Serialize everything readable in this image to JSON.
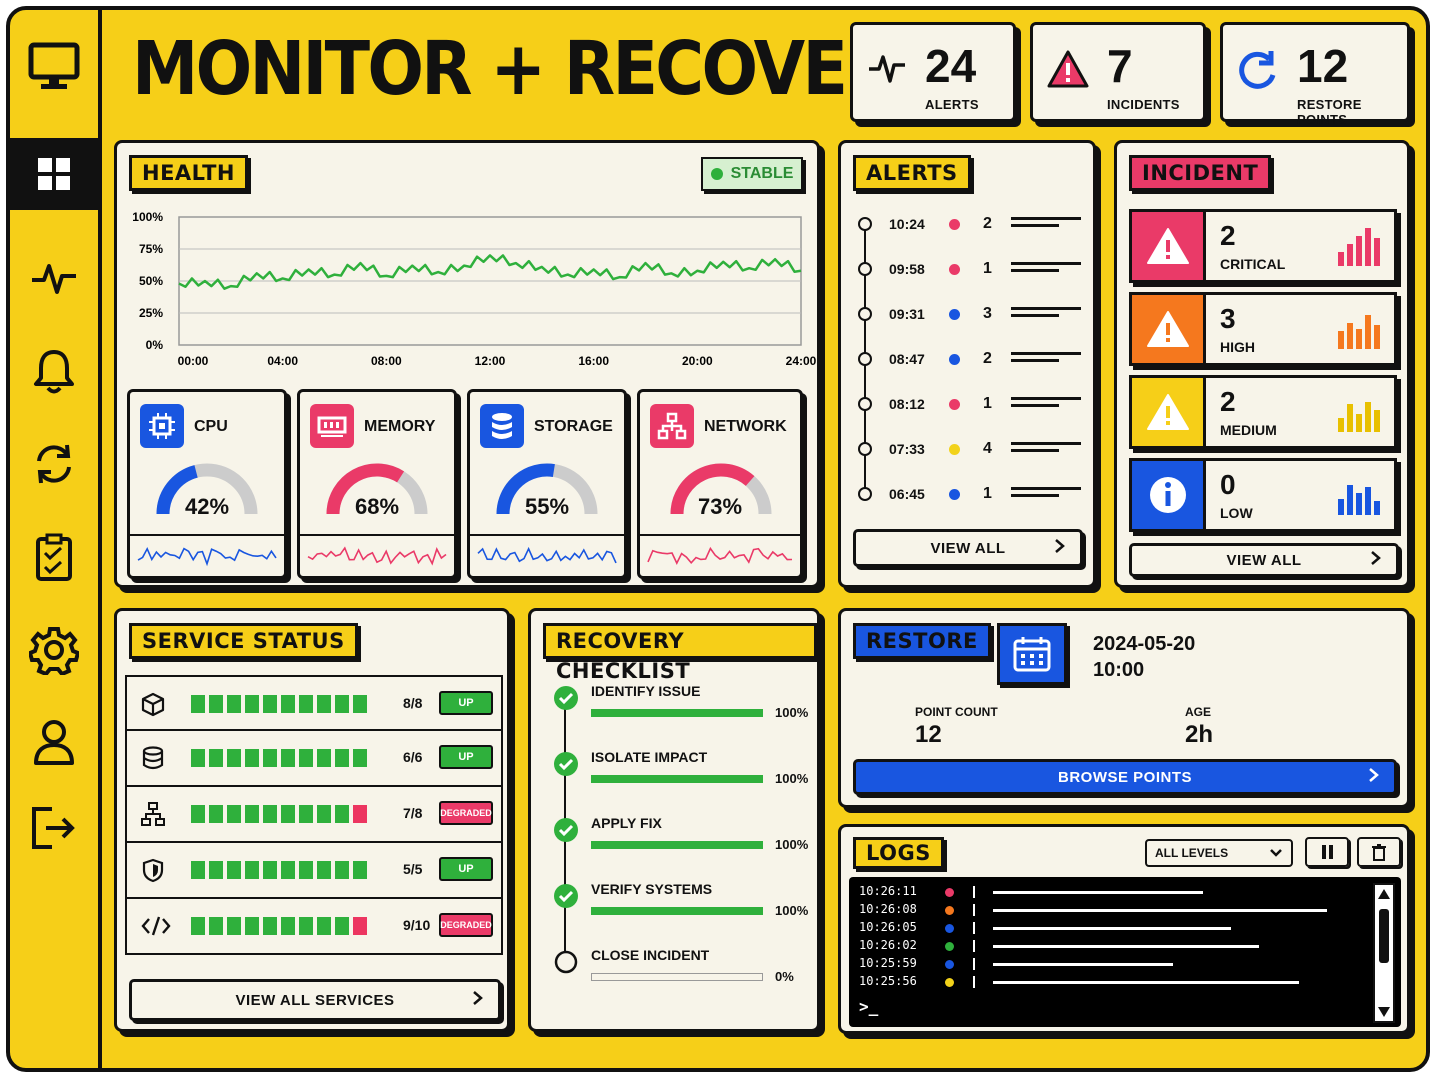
{
  "app": {
    "title": "MONITOR + RECOVER"
  },
  "header_stats": [
    {
      "value": "24",
      "label": "ALERTS",
      "icon": "pulse-icon"
    },
    {
      "value": "7",
      "label": "INCIDENTS",
      "icon": "warning-icon"
    },
    {
      "value": "12",
      "label": "RESTORE POINTS",
      "icon": "restore-icon"
    }
  ],
  "sidebar": {
    "items": [
      "monitor-logo",
      "dashboard",
      "activity",
      "notifications",
      "sync",
      "checklist",
      "settings",
      "profile",
      "logout"
    ]
  },
  "health": {
    "title": "HEALTH",
    "status": "STABLE",
    "y_ticks": [
      "100%",
      "75%",
      "50%",
      "25%",
      "0%"
    ],
    "x_ticks": [
      "00:00",
      "04:00",
      "08:00",
      "12:00",
      "16:00",
      "20:00",
      "24:00"
    ]
  },
  "chart_data": {
    "type": "line",
    "title": "",
    "xlabel": "",
    "ylabel": "",
    "ylim": [
      0,
      100
    ],
    "grid": true,
    "x": [
      "00:00",
      "01:00",
      "02:00",
      "03:00",
      "04:00",
      "05:00",
      "06:00",
      "07:00",
      "08:00",
      "09:00",
      "10:00",
      "11:00",
      "12:00",
      "13:00",
      "14:00",
      "15:00",
      "16:00",
      "17:00",
      "18:00",
      "19:00",
      "20:00",
      "21:00",
      "22:00",
      "23:00",
      "24:00"
    ],
    "series": [
      {
        "values": [
          48,
          50,
          46,
          56,
          52,
          59,
          55,
          64,
          54,
          62,
          57,
          62,
          70,
          64,
          61,
          55,
          59,
          53,
          64,
          56,
          58,
          65,
          60,
          67,
          58
        ]
      }
    ],
    "color": "#2fb03c"
  },
  "metrics": [
    {
      "name": "CPU",
      "percent": 42,
      "label": "42%",
      "color": "#1956e0",
      "icon": "cpu-icon"
    },
    {
      "name": "MEMORY",
      "percent": 68,
      "label": "68%",
      "color": "#ea3a68",
      "icon": "memory-icon"
    },
    {
      "name": "STORAGE",
      "percent": 55,
      "label": "55%",
      "color": "#1956e0",
      "icon": "storage-icon"
    },
    {
      "name": "NETWORK",
      "percent": 73,
      "label": "73%",
      "color": "#ea3a68",
      "icon": "network-icon"
    }
  ],
  "alerts": {
    "title": "ALERTS",
    "items": [
      {
        "time": "10:24",
        "count": "2",
        "color": "#ea3a68"
      },
      {
        "time": "09:58",
        "count": "1",
        "color": "#ea3a68"
      },
      {
        "time": "09:31",
        "count": "3",
        "color": "#1956e0"
      },
      {
        "time": "08:47",
        "count": "2",
        "color": "#1956e0"
      },
      {
        "time": "08:12",
        "count": "1",
        "color": "#ea3a68"
      },
      {
        "time": "07:33",
        "count": "4",
        "color": "#f2d21a"
      },
      {
        "time": "06:45",
        "count": "1",
        "color": "#1956e0"
      }
    ],
    "view_all": "VIEW ALL"
  },
  "incident": {
    "title": "INCIDENT",
    "items": [
      {
        "count": "2",
        "level": "CRITICAL",
        "color": "#ea3a68",
        "icon": "warning-icon"
      },
      {
        "count": "3",
        "level": "HIGH",
        "color": "#f5781e",
        "icon": "warning-icon"
      },
      {
        "count": "2",
        "level": "MEDIUM",
        "color": "#f6cf18",
        "icon": "warning-icon"
      },
      {
        "count": "0",
        "level": "LOW",
        "color": "#1956e0",
        "icon": "info-icon"
      }
    ],
    "view_all": "VIEW ALL"
  },
  "service_status": {
    "title": "SERVICE STATUS",
    "rows": [
      {
        "icon": "cube-icon",
        "count": "8/8",
        "status": "UP",
        "status_color": "#2fb03c",
        "bars_ok": 10,
        "bars_bad": 0
      },
      {
        "icon": "database-icon",
        "count": "6/6",
        "status": "UP",
        "status_color": "#2fb03c",
        "bars_ok": 10,
        "bars_bad": 0
      },
      {
        "icon": "network-icon",
        "count": "7/8",
        "status": "DEGRADED",
        "status_color": "#ea3a68",
        "bars_ok": 9,
        "bars_bad": 1
      },
      {
        "icon": "shield-icon",
        "count": "5/5",
        "status": "UP",
        "status_color": "#2fb03c",
        "bars_ok": 10,
        "bars_bad": 0
      },
      {
        "icon": "code-icon",
        "count": "9/10",
        "status": "DEGRADED",
        "status_color": "#ea3a68",
        "bars_ok": 9,
        "bars_bad": 1
      }
    ],
    "view_all": "VIEW ALL SERVICES"
  },
  "checklist": {
    "title": "RECOVERY CHECKLIST",
    "items": [
      {
        "label": "IDENTIFY ISSUE",
        "progress": "100%",
        "done": true
      },
      {
        "label": "ISOLATE IMPACT",
        "progress": "100%",
        "done": true
      },
      {
        "label": "APPLY FIX",
        "progress": "100%",
        "done": true
      },
      {
        "label": "VERIFY SYSTEMS",
        "progress": "100%",
        "done": true
      },
      {
        "label": "CLOSE INCIDENT",
        "progress": "0%",
        "done": false
      }
    ]
  },
  "restore": {
    "title": "RESTORE",
    "date": "2024-05-20",
    "time": "10:00",
    "point_count_label": "POINT COUNT",
    "point_count": "12",
    "age_label": "AGE",
    "age": "2h",
    "browse": "BROWSE POINTS"
  },
  "logs": {
    "title": "LOGS",
    "filter": "ALL LEVELS",
    "lines": [
      {
        "time": "10:26:11",
        "color": "#ea3a68"
      },
      {
        "time": "10:26:08",
        "color": "#f5781e"
      },
      {
        "time": "10:26:05",
        "color": "#1956e0"
      },
      {
        "time": "10:26:02",
        "color": "#2fb03c"
      },
      {
        "time": "10:25:59",
        "color": "#1956e0"
      },
      {
        "time": "10:25:56",
        "color": "#f2d21a"
      }
    ],
    "prompt": ">_"
  }
}
